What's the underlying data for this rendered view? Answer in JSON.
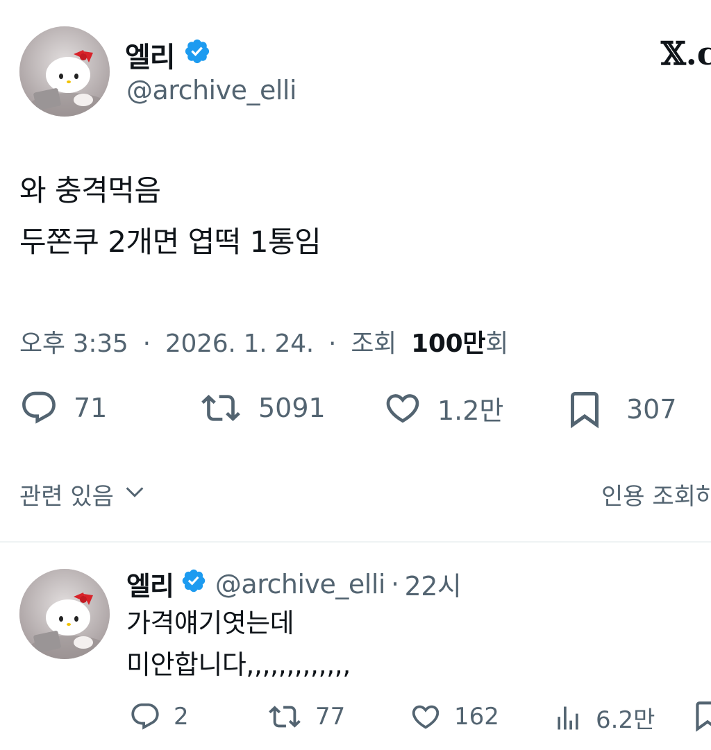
{
  "tweet": {
    "author_name": "엘리",
    "author_handle": "@archive_elli",
    "text_lines": [
      "와 충격먹음",
      "두쫀쿠 2개면 엽떡 1통임"
    ],
    "time": "오후 3:35",
    "date": "2026. 1. 24.",
    "views_label": "조회",
    "views_value": "100만",
    "views_suffix": "회",
    "separator": "·",
    "stats": {
      "replies": "71",
      "retweets": "5091",
      "likes": "1.2만",
      "bookmarks": "307"
    },
    "related_label": "관련 있음",
    "quotes_label": "인용 조회하"
  },
  "brand": {
    "logo_text": "𝕏.c"
  },
  "reply": {
    "author_name": "엘리",
    "author_handle": "@archive_elli",
    "separator": "·",
    "time": "22시",
    "text_lines": [
      "가격얘기엿는데",
      "미안합니다,,,,,,,,,,,,,"
    ],
    "stats": {
      "replies": "2",
      "retweets": "77",
      "likes": "162",
      "views": "6.2만"
    }
  },
  "colors": {
    "text": "#0f1419",
    "muted": "#536471",
    "verified": "#1d9bf0",
    "divider": "#eff3f4"
  },
  "icons": [
    "verified-badge-icon",
    "reply-icon",
    "retweet-icon",
    "like-icon",
    "bookmark-icon",
    "chevron-down-icon",
    "views-icon"
  ]
}
